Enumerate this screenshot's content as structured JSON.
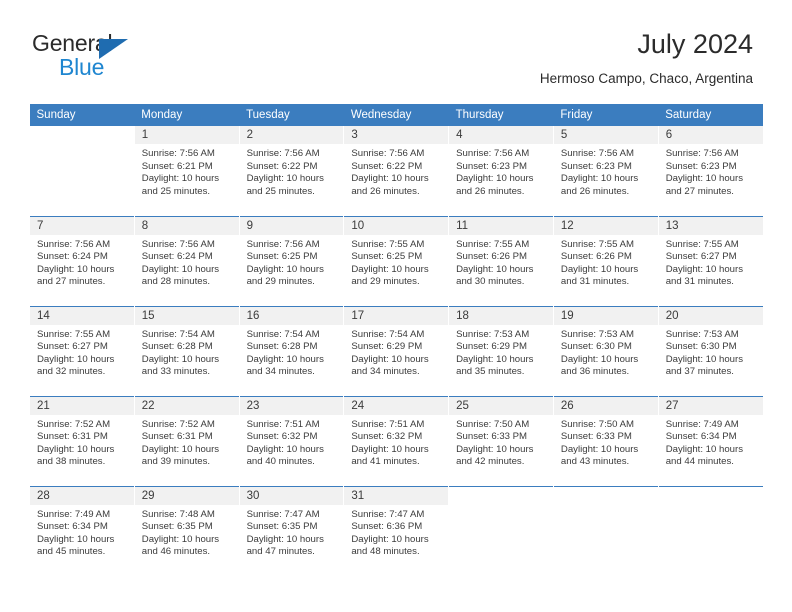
{
  "brand": {
    "name_part1": "General",
    "name_part2": "Blue",
    "triangle_color": "#1f6cb0",
    "blue_text_color": "#1f86d0"
  },
  "header": {
    "title": "July 2024",
    "subtitle": "Hermoso Campo, Chaco, Argentina"
  },
  "theme": {
    "header_row_bg": "#3b7dbf",
    "daynum_bg": "#f1f1f1",
    "text_color": "#3b3b3b",
    "page_bg": "#ffffff"
  },
  "weekdays": [
    "Sunday",
    "Monday",
    "Tuesday",
    "Wednesday",
    "Thursday",
    "Friday",
    "Saturday"
  ],
  "labels": {
    "sunrise_prefix": "Sunrise: ",
    "sunset_prefix": "Sunset: ",
    "daylight_prefix": "Daylight: "
  },
  "weeks": [
    [
      {
        "day": "",
        "blank": true,
        "sunrise": "",
        "sunset": "",
        "daylight_line1": "",
        "daylight_line2": ""
      },
      {
        "day": "1",
        "sunrise": "Sunrise: 7:56 AM",
        "sunset": "Sunset: 6:21 PM",
        "daylight_line1": "Daylight: 10 hours",
        "daylight_line2": "and 25 minutes."
      },
      {
        "day": "2",
        "sunrise": "Sunrise: 7:56 AM",
        "sunset": "Sunset: 6:22 PM",
        "daylight_line1": "Daylight: 10 hours",
        "daylight_line2": "and 25 minutes."
      },
      {
        "day": "3",
        "sunrise": "Sunrise: 7:56 AM",
        "sunset": "Sunset: 6:22 PM",
        "daylight_line1": "Daylight: 10 hours",
        "daylight_line2": "and 26 minutes."
      },
      {
        "day": "4",
        "sunrise": "Sunrise: 7:56 AM",
        "sunset": "Sunset: 6:23 PM",
        "daylight_line1": "Daylight: 10 hours",
        "daylight_line2": "and 26 minutes."
      },
      {
        "day": "5",
        "sunrise": "Sunrise: 7:56 AM",
        "sunset": "Sunset: 6:23 PM",
        "daylight_line1": "Daylight: 10 hours",
        "daylight_line2": "and 26 minutes."
      },
      {
        "day": "6",
        "sunrise": "Sunrise: 7:56 AM",
        "sunset": "Sunset: 6:23 PM",
        "daylight_line1": "Daylight: 10 hours",
        "daylight_line2": "and 27 minutes."
      }
    ],
    [
      {
        "day": "7",
        "sunrise": "Sunrise: 7:56 AM",
        "sunset": "Sunset: 6:24 PM",
        "daylight_line1": "Daylight: 10 hours",
        "daylight_line2": "and 27 minutes."
      },
      {
        "day": "8",
        "sunrise": "Sunrise: 7:56 AM",
        "sunset": "Sunset: 6:24 PM",
        "daylight_line1": "Daylight: 10 hours",
        "daylight_line2": "and 28 minutes."
      },
      {
        "day": "9",
        "sunrise": "Sunrise: 7:56 AM",
        "sunset": "Sunset: 6:25 PM",
        "daylight_line1": "Daylight: 10 hours",
        "daylight_line2": "and 29 minutes."
      },
      {
        "day": "10",
        "sunrise": "Sunrise: 7:55 AM",
        "sunset": "Sunset: 6:25 PM",
        "daylight_line1": "Daylight: 10 hours",
        "daylight_line2": "and 29 minutes."
      },
      {
        "day": "11",
        "sunrise": "Sunrise: 7:55 AM",
        "sunset": "Sunset: 6:26 PM",
        "daylight_line1": "Daylight: 10 hours",
        "daylight_line2": "and 30 minutes."
      },
      {
        "day": "12",
        "sunrise": "Sunrise: 7:55 AM",
        "sunset": "Sunset: 6:26 PM",
        "daylight_line1": "Daylight: 10 hours",
        "daylight_line2": "and 31 minutes."
      },
      {
        "day": "13",
        "sunrise": "Sunrise: 7:55 AM",
        "sunset": "Sunset: 6:27 PM",
        "daylight_line1": "Daylight: 10 hours",
        "daylight_line2": "and 31 minutes."
      }
    ],
    [
      {
        "day": "14",
        "sunrise": "Sunrise: 7:55 AM",
        "sunset": "Sunset: 6:27 PM",
        "daylight_line1": "Daylight: 10 hours",
        "daylight_line2": "and 32 minutes."
      },
      {
        "day": "15",
        "sunrise": "Sunrise: 7:54 AM",
        "sunset": "Sunset: 6:28 PM",
        "daylight_line1": "Daylight: 10 hours",
        "daylight_line2": "and 33 minutes."
      },
      {
        "day": "16",
        "sunrise": "Sunrise: 7:54 AM",
        "sunset": "Sunset: 6:28 PM",
        "daylight_line1": "Daylight: 10 hours",
        "daylight_line2": "and 34 minutes."
      },
      {
        "day": "17",
        "sunrise": "Sunrise: 7:54 AM",
        "sunset": "Sunset: 6:29 PM",
        "daylight_line1": "Daylight: 10 hours",
        "daylight_line2": "and 34 minutes."
      },
      {
        "day": "18",
        "sunrise": "Sunrise: 7:53 AM",
        "sunset": "Sunset: 6:29 PM",
        "daylight_line1": "Daylight: 10 hours",
        "daylight_line2": "and 35 minutes."
      },
      {
        "day": "19",
        "sunrise": "Sunrise: 7:53 AM",
        "sunset": "Sunset: 6:30 PM",
        "daylight_line1": "Daylight: 10 hours",
        "daylight_line2": "and 36 minutes."
      },
      {
        "day": "20",
        "sunrise": "Sunrise: 7:53 AM",
        "sunset": "Sunset: 6:30 PM",
        "daylight_line1": "Daylight: 10 hours",
        "daylight_line2": "and 37 minutes."
      }
    ],
    [
      {
        "day": "21",
        "sunrise": "Sunrise: 7:52 AM",
        "sunset": "Sunset: 6:31 PM",
        "daylight_line1": "Daylight: 10 hours",
        "daylight_line2": "and 38 minutes."
      },
      {
        "day": "22",
        "sunrise": "Sunrise: 7:52 AM",
        "sunset": "Sunset: 6:31 PM",
        "daylight_line1": "Daylight: 10 hours",
        "daylight_line2": "and 39 minutes."
      },
      {
        "day": "23",
        "sunrise": "Sunrise: 7:51 AM",
        "sunset": "Sunset: 6:32 PM",
        "daylight_line1": "Daylight: 10 hours",
        "daylight_line2": "and 40 minutes."
      },
      {
        "day": "24",
        "sunrise": "Sunrise: 7:51 AM",
        "sunset": "Sunset: 6:32 PM",
        "daylight_line1": "Daylight: 10 hours",
        "daylight_line2": "and 41 minutes."
      },
      {
        "day": "25",
        "sunrise": "Sunrise: 7:50 AM",
        "sunset": "Sunset: 6:33 PM",
        "daylight_line1": "Daylight: 10 hours",
        "daylight_line2": "and 42 minutes."
      },
      {
        "day": "26",
        "sunrise": "Sunrise: 7:50 AM",
        "sunset": "Sunset: 6:33 PM",
        "daylight_line1": "Daylight: 10 hours",
        "daylight_line2": "and 43 minutes."
      },
      {
        "day": "27",
        "sunrise": "Sunrise: 7:49 AM",
        "sunset": "Sunset: 6:34 PM",
        "daylight_line1": "Daylight: 10 hours",
        "daylight_line2": "and 44 minutes."
      }
    ],
    [
      {
        "day": "28",
        "sunrise": "Sunrise: 7:49 AM",
        "sunset": "Sunset: 6:34 PM",
        "daylight_line1": "Daylight: 10 hours",
        "daylight_line2": "and 45 minutes."
      },
      {
        "day": "29",
        "sunrise": "Sunrise: 7:48 AM",
        "sunset": "Sunset: 6:35 PM",
        "daylight_line1": "Daylight: 10 hours",
        "daylight_line2": "and 46 minutes."
      },
      {
        "day": "30",
        "sunrise": "Sunrise: 7:47 AM",
        "sunset": "Sunset: 6:35 PM",
        "daylight_line1": "Daylight: 10 hours",
        "daylight_line2": "and 47 minutes."
      },
      {
        "day": "31",
        "sunrise": "Sunrise: 7:47 AM",
        "sunset": "Sunset: 6:36 PM",
        "daylight_line1": "Daylight: 10 hours",
        "daylight_line2": "and 48 minutes."
      },
      {
        "day": "",
        "blank": true,
        "sunrise": "",
        "sunset": "",
        "daylight_line1": "",
        "daylight_line2": ""
      },
      {
        "day": "",
        "blank": true,
        "sunrise": "",
        "sunset": "",
        "daylight_line1": "",
        "daylight_line2": ""
      },
      {
        "day": "",
        "blank": true,
        "sunrise": "",
        "sunset": "",
        "daylight_line1": "",
        "daylight_line2": ""
      }
    ]
  ]
}
